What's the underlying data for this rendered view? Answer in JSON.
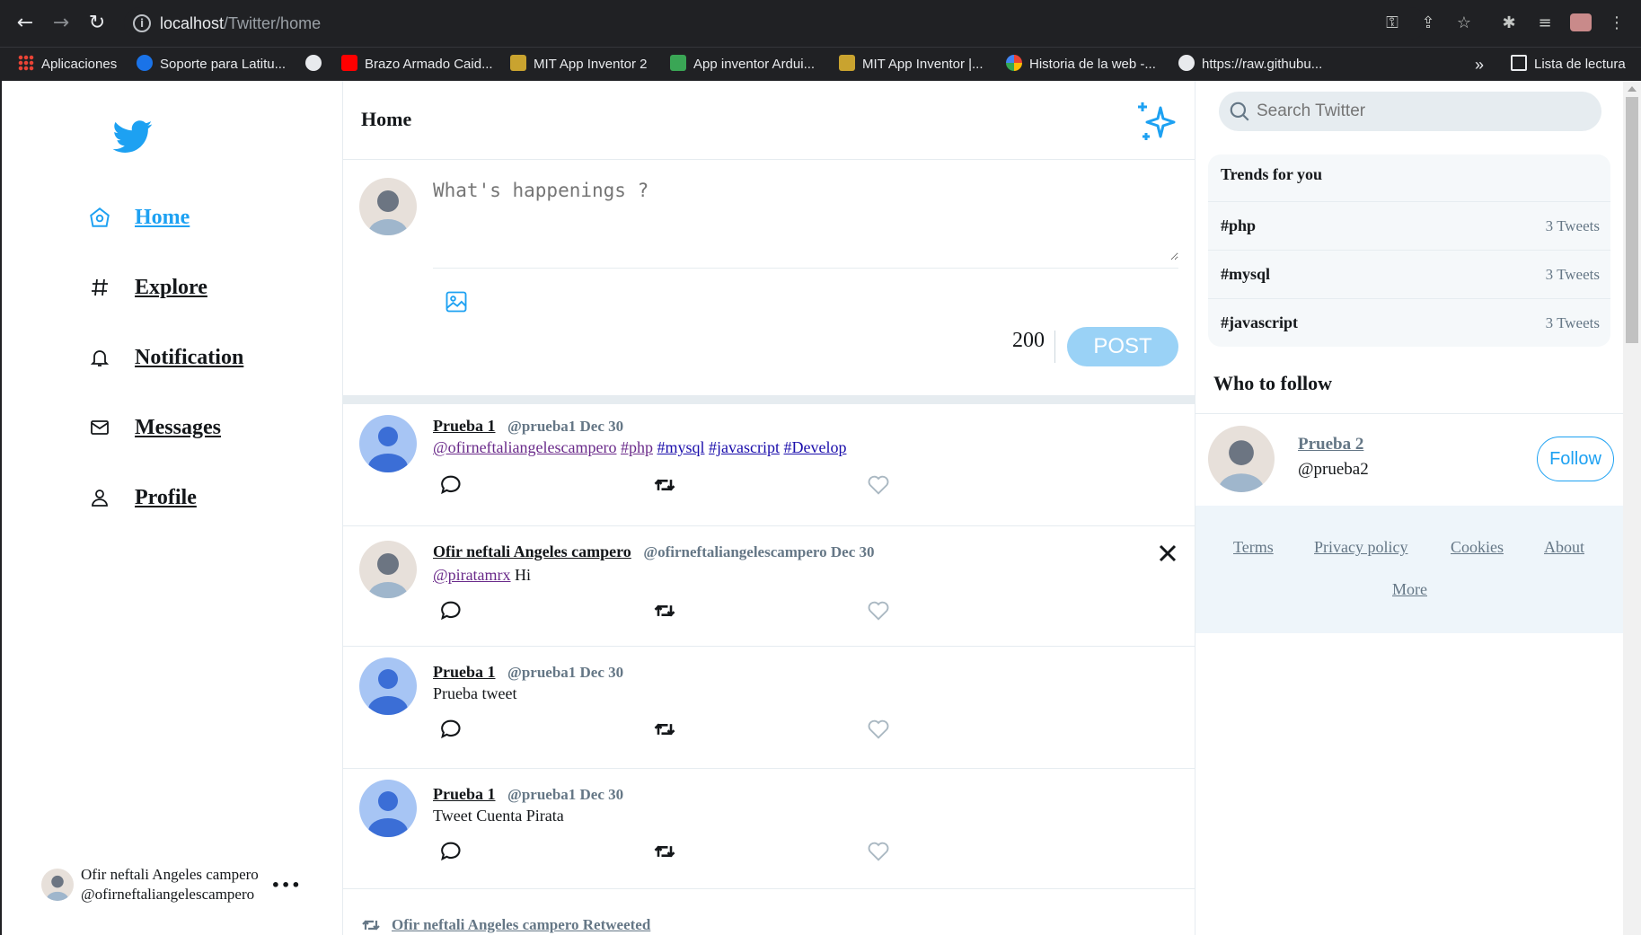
{
  "browser": {
    "url_host": "localhost",
    "url_path": "/Twitter/home",
    "bookmarks": [
      {
        "label": "Aplicaciones",
        "icon": "apps-grid-icon"
      },
      {
        "label": "Soporte para Latitu...",
        "icon": "dell-icon"
      },
      {
        "label": "",
        "icon": "globe-icon"
      },
      {
        "label": "Brazo Armado Caid...",
        "icon": "youtube-icon"
      },
      {
        "label": "MIT App Inventor 2",
        "icon": "app-inventor-icon"
      },
      {
        "label": "App inventor Ardui...",
        "icon": "arduino-icon"
      },
      {
        "label": "MIT App Inventor |...",
        "icon": "app-inventor-icon"
      },
      {
        "label": "Historia de la web -...",
        "icon": "google-icon"
      },
      {
        "label": "https://raw.githubu...",
        "icon": "globe-icon"
      }
    ],
    "more": "»",
    "reading_list": "Lista de lectura"
  },
  "nav": {
    "items": [
      {
        "label": "Home",
        "icon": "home-icon"
      },
      {
        "label": "Explore",
        "icon": "hash-icon"
      },
      {
        "label": "Notification",
        "icon": "bell-icon"
      },
      {
        "label": "Messages",
        "icon": "mail-icon"
      },
      {
        "label": "Profile",
        "icon": "user-icon"
      }
    ],
    "me_name": "Ofir neftali Angeles campero",
    "me_handle": "@ofirneftaliangelescampero",
    "me_more": "•••"
  },
  "header": {
    "title": "Home"
  },
  "compose": {
    "placeholder": "What's happenings ?",
    "counter": "200",
    "post_label": "POST"
  },
  "tweets": [
    {
      "name": "Prueba 1",
      "meta": "@prueba1 Dec 30",
      "mention": "@ofirneftaliangelescampero",
      "tags": [
        "#php",
        "#mysql",
        "#javascript",
        "#Develop"
      ],
      "text": ""
    },
    {
      "name": "Ofir neftali Angeles campero",
      "meta": "@ofirneftaliangelescampero Dec 30",
      "mention": "@piratamrx",
      "text": "Hi"
    },
    {
      "name": "Prueba 1",
      "meta": "@prueba1 Dec 30",
      "mention": "",
      "text": "Prueba tweet"
    },
    {
      "name": "Prueba 1",
      "meta": "@prueba1 Dec 30",
      "mention": "",
      "text": "Tweet Cuenta Pirata"
    }
  ],
  "retweeted": "Ofir neftali Angeles campero Retweeted",
  "search": {
    "placeholder": "Search Twitter"
  },
  "trends": {
    "title": "Trends for you",
    "items": [
      {
        "tag": "#php",
        "count": "3 Tweets"
      },
      {
        "tag": "#mysql",
        "count": "3 Tweets"
      },
      {
        "tag": "#javascript",
        "count": "3 Tweets"
      }
    ]
  },
  "who_to_follow": {
    "title": "Who to follow",
    "name": "Prueba 2",
    "handle": "@prueba2",
    "follow_label": "Follow"
  },
  "footer": {
    "links": [
      "Terms",
      "Privacy policy",
      "Cookies",
      "About",
      "More"
    ]
  },
  "colors": {
    "brand": "#1da1f2",
    "post_disabled": "#9ad2f6",
    "chrome_bg": "#202124"
  }
}
